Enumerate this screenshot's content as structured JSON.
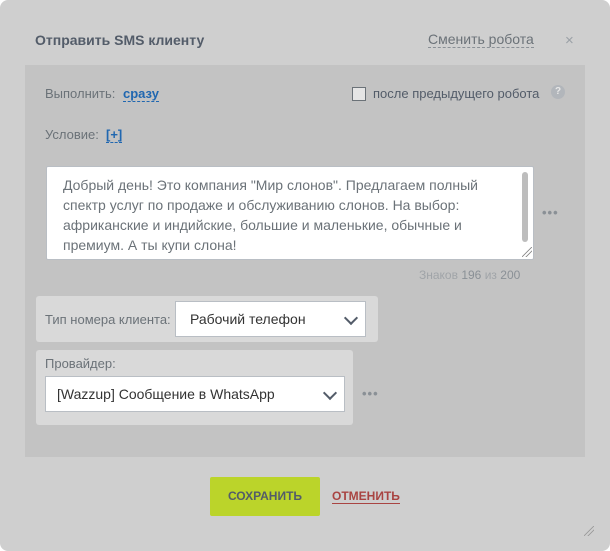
{
  "dialog": {
    "title": "Отправить SMS клиенту",
    "change_robot_label": "Сменить робота",
    "close_glyph": "×"
  },
  "execute": {
    "label": "Выполнить:",
    "value": "сразу",
    "after_previous_label": "после предыдущего робота",
    "after_previous_checked": false,
    "help_glyph": "?"
  },
  "condition": {
    "label": "Условие:",
    "add_label": "[+]"
  },
  "message": {
    "text": "Добрый день! Это компания \"Мир слонов\". Предлагаем полный спектр услуг по продаже и обслуживанию слонов. На выбор: африканские и индийские, большие и маленькие, обычные и премиум. А ты купи слона!",
    "more_glyph": "•••",
    "counter_label": "Знаков",
    "counter_value": "196",
    "counter_of": "из",
    "counter_max": "200"
  },
  "phone_type": {
    "label": "Тип номера клиента:",
    "selected": "Рабочий телефон"
  },
  "provider": {
    "label": "Провайдер:",
    "selected": "[Wazzup] Сообщение в WhatsApp",
    "more_glyph": "•••"
  },
  "buttons": {
    "save": "СОХРАНИТЬ",
    "cancel": "ОТМЕНИТЬ"
  },
  "colors": {
    "save_button": "#bbd42a",
    "cancel_link": "#a94442",
    "link": "#2067b0"
  }
}
